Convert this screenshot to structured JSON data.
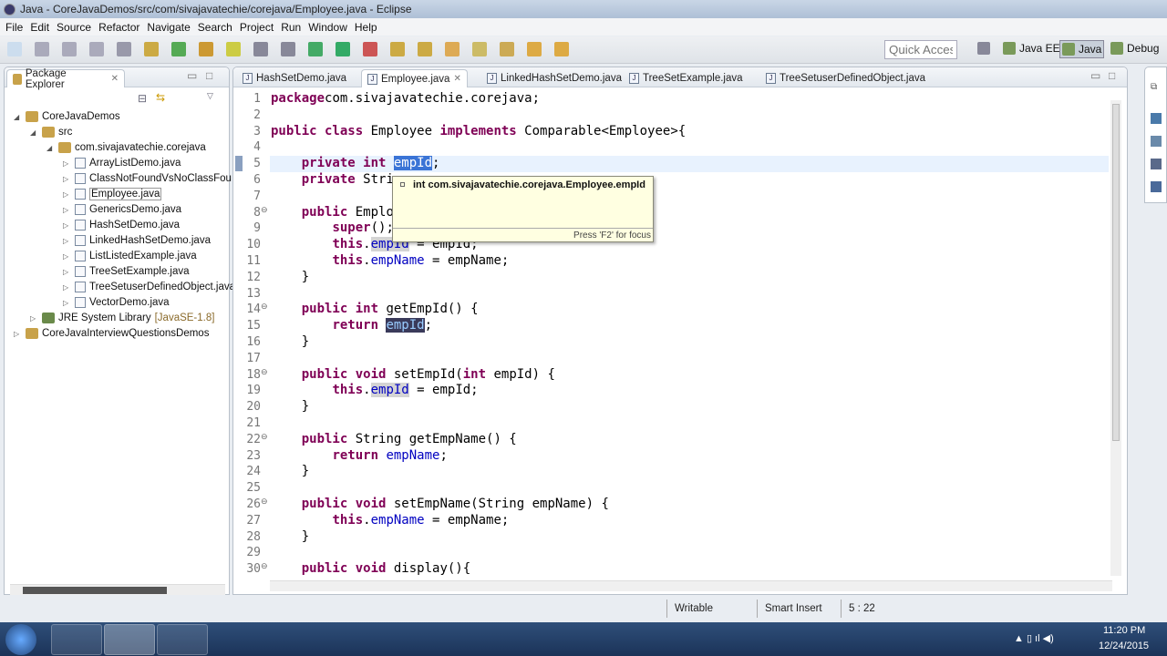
{
  "window": {
    "title": "Java - CoreJavaDemos/src/com/sivajavatechie/corejava/Employee.java - Eclipse"
  },
  "menu": [
    "File",
    "Edit",
    "Source",
    "Refactor",
    "Navigate",
    "Search",
    "Project",
    "Run",
    "Window",
    "Help"
  ],
  "quick_access": {
    "placeholder": "Quick Access"
  },
  "perspectives": [
    {
      "label": "Java EE",
      "active": false
    },
    {
      "label": "Java",
      "active": true
    },
    {
      "label": "Debug",
      "active": false
    }
  ],
  "package_explorer": {
    "title": "Package Explorer",
    "tree": [
      {
        "label": "CoreJavaDemos",
        "level": 0,
        "expanded": true,
        "icon": "project-icon"
      },
      {
        "label": "src",
        "level": 1,
        "expanded": true,
        "icon": "source-folder-icon"
      },
      {
        "label": "com.sivajavatechie.corejava",
        "level": 2,
        "expanded": true,
        "icon": "package-icon"
      },
      {
        "label": "ArrayListDemo.java",
        "level": 3,
        "icon": "java-file-icon"
      },
      {
        "label": "ClassNotFoundVsNoClassFou",
        "level": 3,
        "icon": "java-file-icon"
      },
      {
        "label": "Employee.java",
        "level": 3,
        "icon": "java-file-icon",
        "selected": true
      },
      {
        "label": "GenericsDemo.java",
        "level": 3,
        "icon": "java-file-icon"
      },
      {
        "label": "HashSetDemo.java",
        "level": 3,
        "icon": "java-file-icon"
      },
      {
        "label": "LinkedHashSetDemo.java",
        "level": 3,
        "icon": "java-file-icon"
      },
      {
        "label": "ListListedExample.java",
        "level": 3,
        "icon": "java-file-icon"
      },
      {
        "label": "TreeSetExample.java",
        "level": 3,
        "icon": "java-file-icon"
      },
      {
        "label": "TreeSetuserDefinedObject.java",
        "level": 3,
        "icon": "java-file-icon"
      },
      {
        "label": "VectorDemo.java",
        "level": 3,
        "icon": "java-file-icon"
      },
      {
        "label": "JRE System Library",
        "suffix": "[JavaSE-1.8]",
        "level": 1,
        "icon": "library-icon"
      },
      {
        "label": "CoreJavaInterviewQuestionsDemos",
        "level": 0,
        "expanded": false,
        "icon": "project-icon"
      }
    ]
  },
  "editor": {
    "tabs": [
      {
        "label": "HashSetDemo.java",
        "active": false
      },
      {
        "label": "Employee.java",
        "active": true
      },
      {
        "label": "LinkedHashSetDemo.java",
        "active": false
      },
      {
        "label": "TreeSetExample.java",
        "active": false
      },
      {
        "label": "TreeSetuserDefinedObject.java",
        "active": false
      }
    ],
    "lines": [
      {
        "n": "1",
        "s": [
          [
            "kw",
            "package"
          ],
          [
            "",
            "com.sivajavatechie.corejava;"
          ]
        ]
      },
      {
        "n": "2",
        "s": []
      },
      {
        "n": "3",
        "s": [
          [
            "kw",
            "public class"
          ],
          [
            "",
            " Employee "
          ],
          [
            "kw",
            "implements"
          ],
          [
            "",
            " Comparable<Employee>{"
          ]
        ]
      },
      {
        "n": "4",
        "s": []
      },
      {
        "n": "5",
        "s": [
          [
            "",
            "    "
          ],
          [
            "kw",
            "private int"
          ],
          [
            "",
            " "
          ],
          [
            "sel",
            "empId"
          ],
          [
            "",
            ";"
          ]
        ],
        "current": true
      },
      {
        "n": "6",
        "s": [
          [
            "",
            "    "
          ],
          [
            "kw",
            "private"
          ],
          [
            "",
            " Stri"
          ]
        ]
      },
      {
        "n": "7",
        "s": []
      },
      {
        "n": "8",
        "fold": true,
        "s": [
          [
            "",
            "    "
          ],
          [
            "kw",
            "public"
          ],
          [
            "",
            " Emplo"
          ]
        ]
      },
      {
        "n": "9",
        "s": [
          [
            "",
            "        "
          ],
          [
            "kw",
            "super"
          ],
          [
            "",
            "();"
          ]
        ]
      },
      {
        "n": "10",
        "s": [
          [
            "",
            "        "
          ],
          [
            "kw",
            "this"
          ],
          [
            "",
            "."
          ],
          [
            "fld hl",
            "empId"
          ],
          [
            "",
            " = empId;"
          ]
        ]
      },
      {
        "n": "11",
        "s": [
          [
            "",
            "        "
          ],
          [
            "kw",
            "this"
          ],
          [
            "",
            "."
          ],
          [
            "fld",
            "empName"
          ],
          [
            "",
            " = empName;"
          ]
        ]
      },
      {
        "n": "12",
        "s": [
          [
            "",
            "    }"
          ]
        ]
      },
      {
        "n": "13",
        "s": []
      },
      {
        "n": "14",
        "fold": true,
        "s": [
          [
            "",
            "    "
          ],
          [
            "kw",
            "public int"
          ],
          [
            "",
            " getEmpId() {"
          ]
        ]
      },
      {
        "n": "15",
        "s": [
          [
            "",
            "        "
          ],
          [
            "kw",
            "return"
          ],
          [
            "",
            " "
          ],
          [
            "dark",
            "empId"
          ],
          [
            "",
            ";"
          ]
        ]
      },
      {
        "n": "16",
        "s": [
          [
            "",
            "    }"
          ]
        ]
      },
      {
        "n": "17",
        "s": []
      },
      {
        "n": "18",
        "fold": true,
        "s": [
          [
            "",
            "    "
          ],
          [
            "kw",
            "public void"
          ],
          [
            "",
            " setEmpId("
          ],
          [
            "kw",
            "int"
          ],
          [
            "",
            " empId) {"
          ]
        ]
      },
      {
        "n": "19",
        "s": [
          [
            "",
            "        "
          ],
          [
            "kw",
            "this"
          ],
          [
            "",
            "."
          ],
          [
            "fld hl",
            "empId"
          ],
          [
            "",
            " = empId;"
          ]
        ]
      },
      {
        "n": "20",
        "s": [
          [
            "",
            "    }"
          ]
        ]
      },
      {
        "n": "21",
        "s": []
      },
      {
        "n": "22",
        "fold": true,
        "s": [
          [
            "",
            "    "
          ],
          [
            "kw",
            "public"
          ],
          [
            "",
            " String getEmpName() {"
          ]
        ]
      },
      {
        "n": "23",
        "s": [
          [
            "",
            "        "
          ],
          [
            "kw",
            "return"
          ],
          [
            "",
            " "
          ],
          [
            "fld",
            "empName"
          ],
          [
            "",
            ";"
          ]
        ]
      },
      {
        "n": "24",
        "s": [
          [
            "",
            "    }"
          ]
        ]
      },
      {
        "n": "25",
        "s": []
      },
      {
        "n": "26",
        "fold": true,
        "s": [
          [
            "",
            "    "
          ],
          [
            "kw",
            "public void"
          ],
          [
            "",
            " setEmpName(String empName) {"
          ]
        ]
      },
      {
        "n": "27",
        "s": [
          [
            "",
            "        "
          ],
          [
            "kw",
            "this"
          ],
          [
            "",
            "."
          ],
          [
            "fld",
            "empName"
          ],
          [
            "",
            " = empName;"
          ]
        ]
      },
      {
        "n": "28",
        "s": [
          [
            "",
            "    }"
          ]
        ]
      },
      {
        "n": "29",
        "s": []
      },
      {
        "n": "30",
        "fold": true,
        "s": [
          [
            "",
            "    "
          ],
          [
            "kw",
            "public void"
          ],
          [
            "",
            " display(){"
          ]
        ]
      }
    ]
  },
  "tooltip": {
    "text": "int com.sivajavatechie.corejava.Employee.empId",
    "footer": "Press 'F2' for focus"
  },
  "status": {
    "writable": "Writable",
    "insert_mode": "Smart Insert",
    "position": "5 : 22"
  },
  "taskbar": {
    "time": "11:20 PM",
    "date": "12/24/2015"
  }
}
